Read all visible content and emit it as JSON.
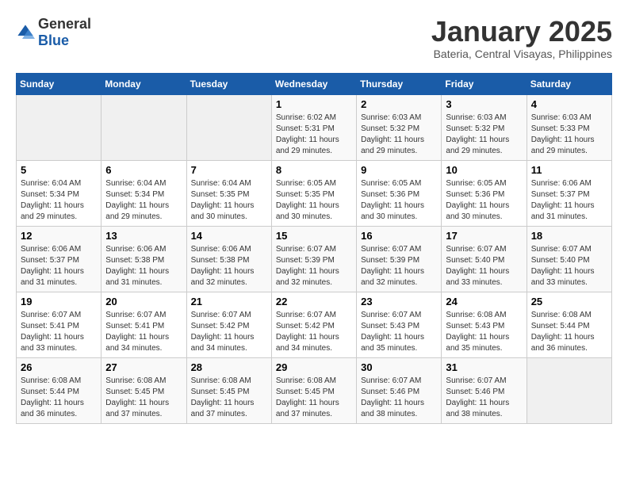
{
  "logo": {
    "general": "General",
    "blue": "Blue"
  },
  "title": "January 2025",
  "subtitle": "Bateria, Central Visayas, Philippines",
  "days_of_week": [
    "Sunday",
    "Monday",
    "Tuesday",
    "Wednesday",
    "Thursday",
    "Friday",
    "Saturday"
  ],
  "weeks": [
    [
      {
        "day": "",
        "empty": true
      },
      {
        "day": "",
        "empty": true
      },
      {
        "day": "",
        "empty": true
      },
      {
        "day": "1",
        "sunrise": "6:02 AM",
        "sunset": "5:31 PM",
        "daylight": "11 hours and 29 minutes."
      },
      {
        "day": "2",
        "sunrise": "6:03 AM",
        "sunset": "5:32 PM",
        "daylight": "11 hours and 29 minutes."
      },
      {
        "day": "3",
        "sunrise": "6:03 AM",
        "sunset": "5:32 PM",
        "daylight": "11 hours and 29 minutes."
      },
      {
        "day": "4",
        "sunrise": "6:03 AM",
        "sunset": "5:33 PM",
        "daylight": "11 hours and 29 minutes."
      }
    ],
    [
      {
        "day": "5",
        "sunrise": "6:04 AM",
        "sunset": "5:34 PM",
        "daylight": "11 hours and 29 minutes."
      },
      {
        "day": "6",
        "sunrise": "6:04 AM",
        "sunset": "5:34 PM",
        "daylight": "11 hours and 29 minutes."
      },
      {
        "day": "7",
        "sunrise": "6:04 AM",
        "sunset": "5:35 PM",
        "daylight": "11 hours and 30 minutes."
      },
      {
        "day": "8",
        "sunrise": "6:05 AM",
        "sunset": "5:35 PM",
        "daylight": "11 hours and 30 minutes."
      },
      {
        "day": "9",
        "sunrise": "6:05 AM",
        "sunset": "5:36 PM",
        "daylight": "11 hours and 30 minutes."
      },
      {
        "day": "10",
        "sunrise": "6:05 AM",
        "sunset": "5:36 PM",
        "daylight": "11 hours and 30 minutes."
      },
      {
        "day": "11",
        "sunrise": "6:06 AM",
        "sunset": "5:37 PM",
        "daylight": "11 hours and 31 minutes."
      }
    ],
    [
      {
        "day": "12",
        "sunrise": "6:06 AM",
        "sunset": "5:37 PM",
        "daylight": "11 hours and 31 minutes."
      },
      {
        "day": "13",
        "sunrise": "6:06 AM",
        "sunset": "5:38 PM",
        "daylight": "11 hours and 31 minutes."
      },
      {
        "day": "14",
        "sunrise": "6:06 AM",
        "sunset": "5:38 PM",
        "daylight": "11 hours and 32 minutes."
      },
      {
        "day": "15",
        "sunrise": "6:07 AM",
        "sunset": "5:39 PM",
        "daylight": "11 hours and 32 minutes."
      },
      {
        "day": "16",
        "sunrise": "6:07 AM",
        "sunset": "5:39 PM",
        "daylight": "11 hours and 32 minutes."
      },
      {
        "day": "17",
        "sunrise": "6:07 AM",
        "sunset": "5:40 PM",
        "daylight": "11 hours and 33 minutes."
      },
      {
        "day": "18",
        "sunrise": "6:07 AM",
        "sunset": "5:40 PM",
        "daylight": "11 hours and 33 minutes."
      }
    ],
    [
      {
        "day": "19",
        "sunrise": "6:07 AM",
        "sunset": "5:41 PM",
        "daylight": "11 hours and 33 minutes."
      },
      {
        "day": "20",
        "sunrise": "6:07 AM",
        "sunset": "5:41 PM",
        "daylight": "11 hours and 34 minutes."
      },
      {
        "day": "21",
        "sunrise": "6:07 AM",
        "sunset": "5:42 PM",
        "daylight": "11 hours and 34 minutes."
      },
      {
        "day": "22",
        "sunrise": "6:07 AM",
        "sunset": "5:42 PM",
        "daylight": "11 hours and 34 minutes."
      },
      {
        "day": "23",
        "sunrise": "6:07 AM",
        "sunset": "5:43 PM",
        "daylight": "11 hours and 35 minutes."
      },
      {
        "day": "24",
        "sunrise": "6:08 AM",
        "sunset": "5:43 PM",
        "daylight": "11 hours and 35 minutes."
      },
      {
        "day": "25",
        "sunrise": "6:08 AM",
        "sunset": "5:44 PM",
        "daylight": "11 hours and 36 minutes."
      }
    ],
    [
      {
        "day": "26",
        "sunrise": "6:08 AM",
        "sunset": "5:44 PM",
        "daylight": "11 hours and 36 minutes."
      },
      {
        "day": "27",
        "sunrise": "6:08 AM",
        "sunset": "5:45 PM",
        "daylight": "11 hours and 37 minutes."
      },
      {
        "day": "28",
        "sunrise": "6:08 AM",
        "sunset": "5:45 PM",
        "daylight": "11 hours and 37 minutes."
      },
      {
        "day": "29",
        "sunrise": "6:08 AM",
        "sunset": "5:45 PM",
        "daylight": "11 hours and 37 minutes."
      },
      {
        "day": "30",
        "sunrise": "6:07 AM",
        "sunset": "5:46 PM",
        "daylight": "11 hours and 38 minutes."
      },
      {
        "day": "31",
        "sunrise": "6:07 AM",
        "sunset": "5:46 PM",
        "daylight": "11 hours and 38 minutes."
      },
      {
        "day": "",
        "empty": true
      }
    ]
  ],
  "labels": {
    "sunrise": "Sunrise:",
    "sunset": "Sunset:",
    "daylight": "Daylight:"
  }
}
